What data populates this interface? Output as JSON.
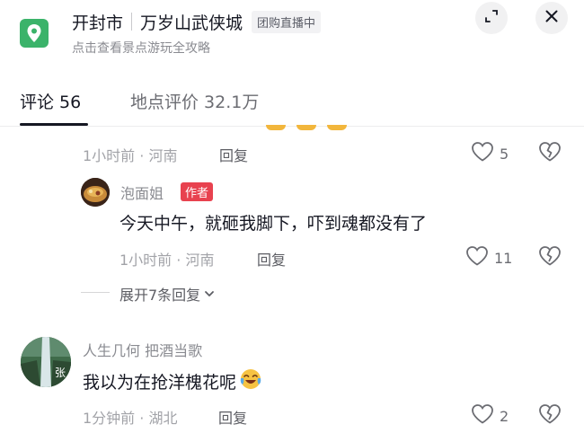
{
  "header": {
    "city": "开封市",
    "place": "万岁山武侠城",
    "tag": "团购直播中",
    "subtitle": "点击查看景点游玩全攻略",
    "icons": {
      "badge": "map-pin-icon",
      "expand": "minimize-icon",
      "close": "close-icon"
    }
  },
  "tabs": [
    {
      "label": "评论 56",
      "active": true
    },
    {
      "label": "地点评价 32.1万",
      "active": false
    }
  ],
  "comment1": {
    "time_location": "1小时前 · 河南",
    "reply_label": "回复",
    "like_count": "5"
  },
  "reply1": {
    "author": "泡面姐",
    "badge": "作者",
    "text": "今天中午，就砸我脚下，吓到魂都没有了",
    "time_location": "1小时前 · 河南",
    "reply_label": "回复",
    "like_count": "11"
  },
  "expand_replies": {
    "label": "展开7条回复"
  },
  "comment2": {
    "user": "人生几何  把酒当歌",
    "text": "我以为在抢洋槐花呢",
    "time_location": "1分钟前 · 湖北",
    "reply_label": "回复",
    "like_count": "2",
    "avatar_text": "张"
  },
  "colors": {
    "accent_green": "#3bb36a",
    "author_badge": "#e8424f",
    "text_primary": "#161823",
    "text_meta": "#a2a3a8"
  }
}
